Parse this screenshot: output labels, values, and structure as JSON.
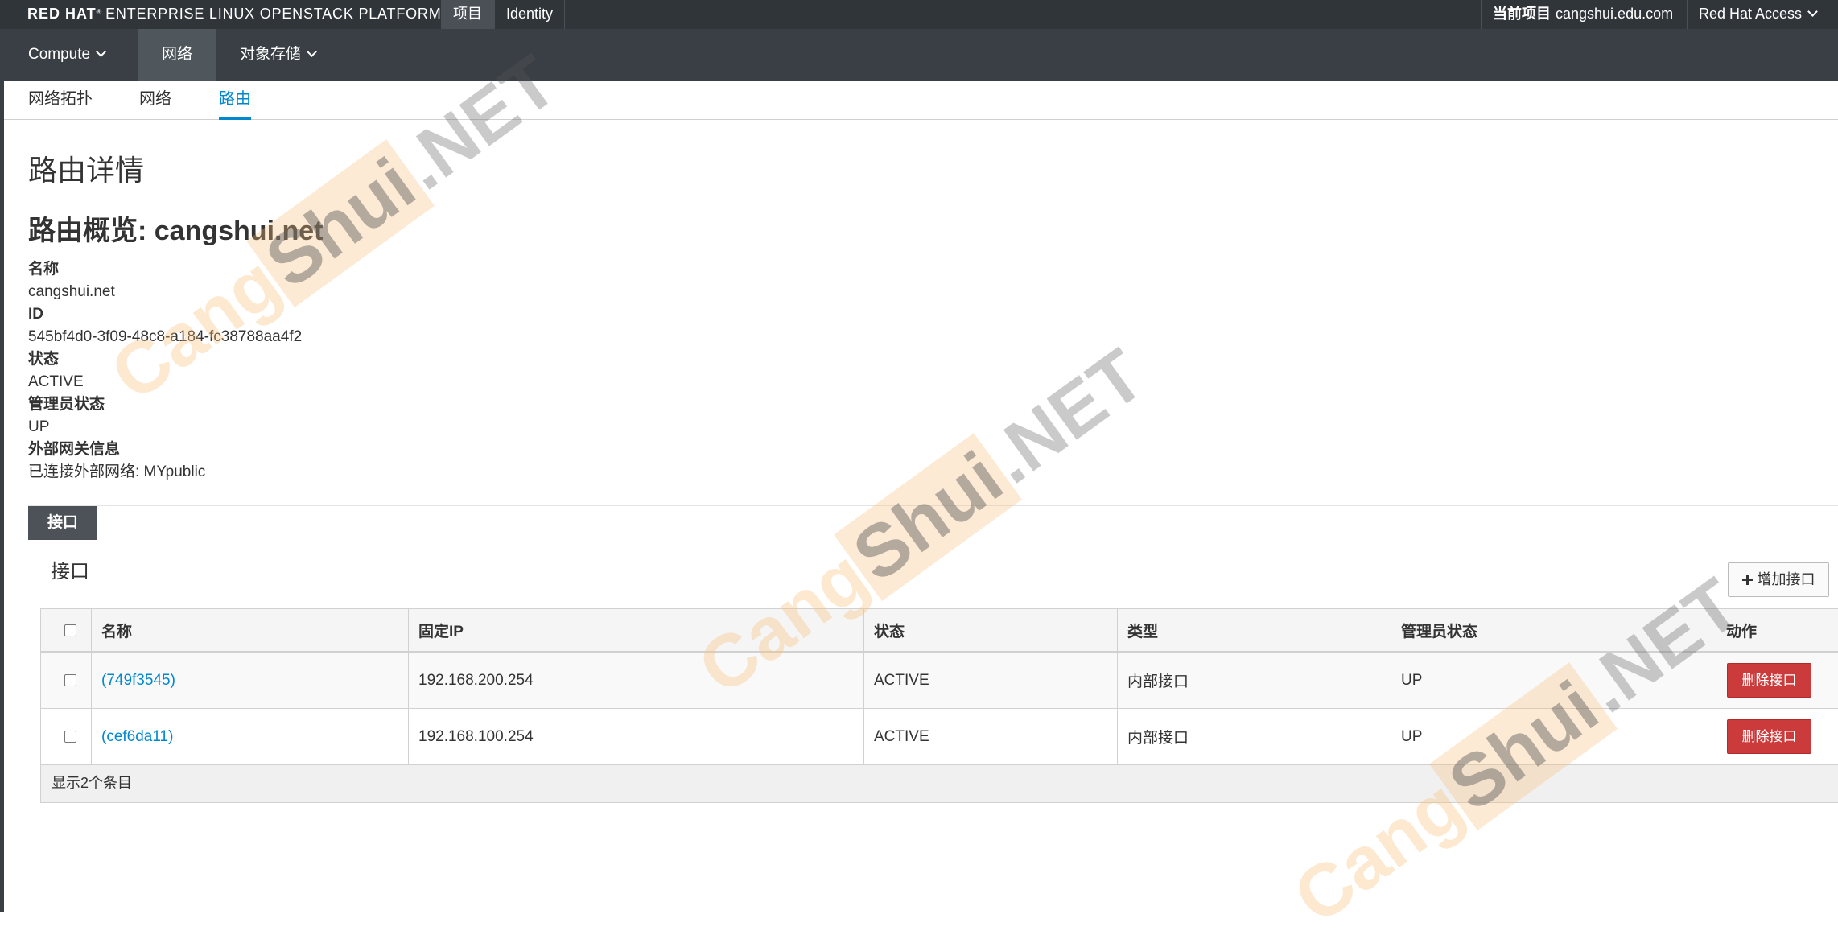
{
  "topbar": {
    "brand_rh": "RED HAT",
    "brand_reg": "®",
    "brand_rest": "ENTERPRISE LINUX OPENSTACK PLATFORM",
    "nav_project": "项目",
    "nav_identity": "Identity",
    "current_project_label": "当前项目",
    "current_project_value": "cangshui.edu.com",
    "help_menu": "Red Hat Access"
  },
  "mainnav": {
    "compute": "Compute",
    "network": "网络",
    "object_storage": "对象存储"
  },
  "tabs": {
    "topology": "网络拓扑",
    "networks": "网络",
    "routers": "路由"
  },
  "page": {
    "title": "路由详情",
    "overview_title": "路由概览: cangshui.net"
  },
  "details": {
    "name_label": "名称",
    "name_value": "cangshui.net",
    "id_label": "ID",
    "id_value": "545bf4d0-3f09-48c8-a184-fc38788aa4f2",
    "status_label": "状态",
    "status_value": "ACTIVE",
    "admin_label": "管理员状态",
    "admin_value": "UP",
    "gateway_label": "外部网关信息",
    "gateway_value": "已连接外部网络: MYpublic"
  },
  "interfaces": {
    "section_tab": "接口",
    "panel_title": "接口",
    "add_button": "增加接口",
    "columns": {
      "name": "名称",
      "fixed_ip": "固定IP",
      "status": "状态",
      "type": "类型",
      "admin_state": "管理员状态",
      "actions": "动作"
    },
    "rows": [
      {
        "name": "(749f3545)",
        "fixed_ip": "192.168.200.254",
        "status": "ACTIVE",
        "type": "内部接口",
        "admin_state": "UP",
        "action": "删除接口"
      },
      {
        "name": "(cef6da11)",
        "fixed_ip": "192.168.100.254",
        "status": "ACTIVE",
        "type": "内部接口",
        "admin_state": "UP",
        "action": "删除接口"
      }
    ],
    "footer": "显示2个条目"
  },
  "watermark": {
    "part1": "Cang",
    "part2": "Shui",
    "part3": ".NET"
  },
  "colors": {
    "topbar": "#30353a",
    "navbar": "#393f44",
    "link": "#0088ce",
    "danger": "#cc3b3b"
  }
}
